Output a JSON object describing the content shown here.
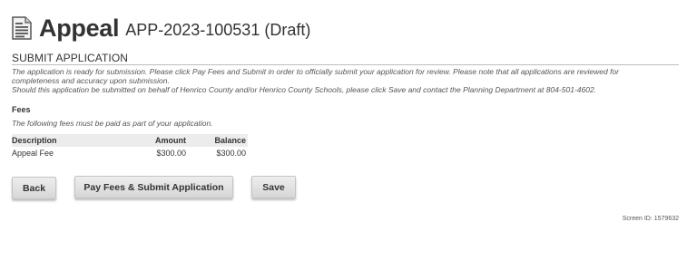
{
  "header": {
    "icon": "document-icon",
    "title": "Appeal",
    "application_id": "APP-2023-100531 (Draft)"
  },
  "section": {
    "title": "SUBMIT APPLICATION",
    "intro_lines": [
      "The application is ready for submission. Please click Pay Fees and Submit in order to officially submit your application for review. Please note that all applications are reviewed for",
      "completeness and accuracy upon submission.",
      "Should this application be submitted on behalf of Henrico County and/or Henrico County Schools, please click Save and contact the Planning Department at 804-501-4602."
    ]
  },
  "fees": {
    "heading": "Fees",
    "note": "The following fees must be paid as part of your application.",
    "columns": [
      "Description",
      "Amount",
      "Balance"
    ],
    "rows": [
      {
        "description": "Appeal Fee",
        "amount": "$300.00",
        "balance": "$300.00"
      }
    ]
  },
  "buttons": {
    "back": "Back",
    "pay_submit": "Pay Fees & Submit Application",
    "save": "Save"
  },
  "footer": {
    "screen_id": "Screen ID: 1579632"
  }
}
